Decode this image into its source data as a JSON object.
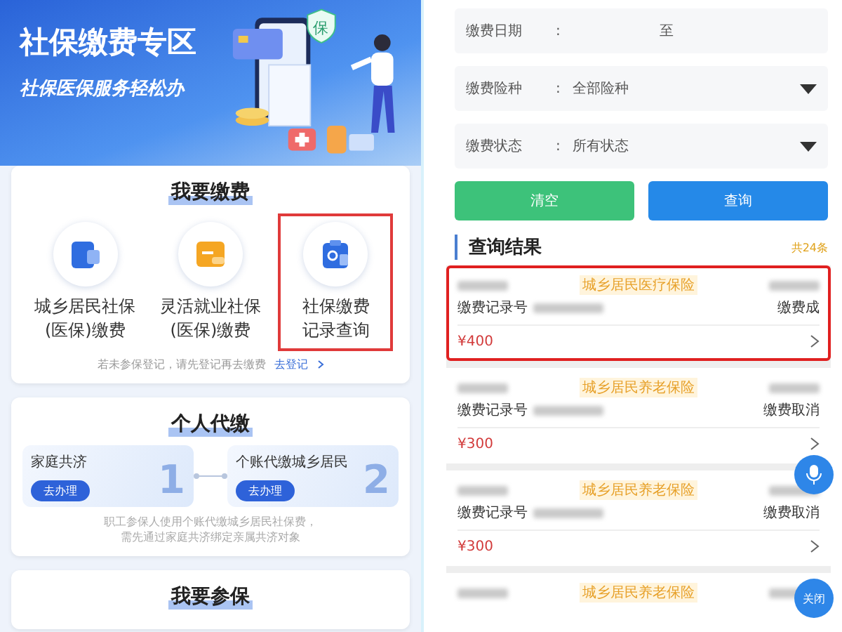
{
  "left": {
    "banner": {
      "title": "社保缴费专区",
      "subtitle": "社保医保服务轻松办",
      "badge": "保"
    },
    "pay_section": {
      "title": "我要缴费",
      "items": [
        {
          "label": [
            "城乡居民社保",
            "(医保)缴费"
          ],
          "kind": "blue",
          "highlighted": false
        },
        {
          "label": [
            "灵活就业社保",
            "(医保)缴费"
          ],
          "kind": "orange",
          "highlighted": false
        },
        {
          "label": [
            "社保缴费",
            "记录查询"
          ],
          "kind": "query",
          "highlighted": true
        }
      ],
      "hint": "若未参保登记，请先登记再去缴费",
      "link": "去登记"
    },
    "proxy_section": {
      "title": "个人代缴",
      "steps": [
        {
          "label": "家庭共济",
          "button": "去办理",
          "number": "1"
        },
        {
          "label": "个账代缴城乡居民",
          "button": "去办理",
          "number": "2"
        }
      ],
      "note": [
        "职工参保人使用个账代缴城乡居民社保费，",
        "需先通过家庭共济绑定亲属共济对象"
      ]
    },
    "enroll_section": {
      "title": "我要参保"
    }
  },
  "right": {
    "filters": [
      {
        "label": "缴费日期",
        "colon": ":",
        "kind": "date",
        "separator": "至"
      },
      {
        "label": "缴费险种",
        "colon": ":",
        "kind": "select",
        "value": "全部险种"
      },
      {
        "label": "缴费状态",
        "colon": ":",
        "kind": "select",
        "value": "所有状态"
      }
    ],
    "buttons": [
      {
        "label": "清空",
        "kind": "clear"
      },
      {
        "label": "查询",
        "kind": "search"
      }
    ],
    "results": {
      "title": "查询结果",
      "count": "共24条",
      "records": [
        {
          "insurance": "城乡居民医疗保险",
          "record_no_label": "缴费记录号",
          "status": "缴费成",
          "amount": "¥400",
          "highlighted": true
        },
        {
          "insurance": "城乡居民养老保险",
          "record_no_label": "缴费记录号",
          "status": "缴费取消",
          "amount": "¥300",
          "highlighted": false
        },
        {
          "insurance": "城乡居民养老保险",
          "record_no_label": "缴费记录号",
          "status": "缴费取消",
          "amount": "¥300",
          "highlighted": false
        },
        {
          "insurance": "城乡居民养老保险",
          "highlighted": false
        }
      ]
    },
    "float_buttons": {
      "close": "关闭"
    }
  }
}
